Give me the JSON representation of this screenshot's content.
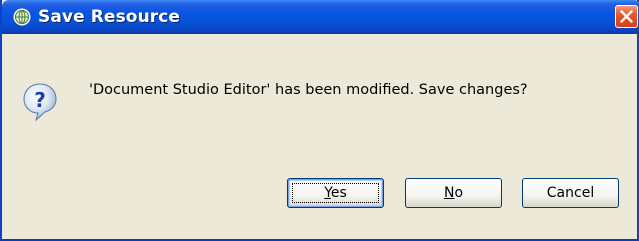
{
  "window": {
    "title": "Save Resource",
    "title_icon": "app-globe-icon",
    "close_icon": "close-icon",
    "accent_color": "#0a55e3",
    "close_color": "#e6582c"
  },
  "dialog": {
    "icon": "question-icon",
    "message": "'Document Studio Editor' has been modified. Save changes?"
  },
  "buttons": {
    "yes": {
      "mnemonic": "Y",
      "rest": "es"
    },
    "no": {
      "mnemonic": "N",
      "rest": "o"
    },
    "cancel": {
      "label": "Cancel"
    }
  }
}
